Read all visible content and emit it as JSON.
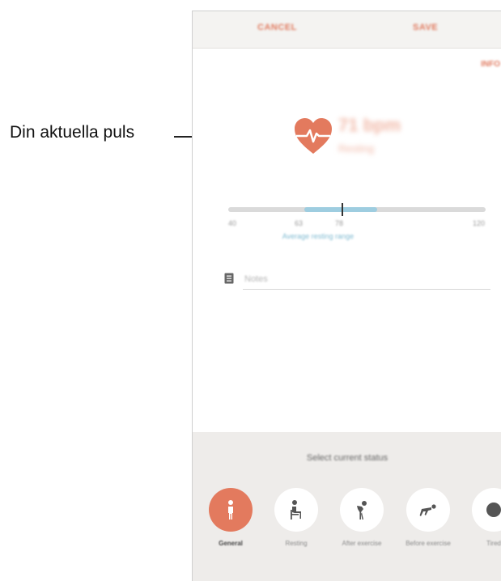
{
  "callout": {
    "label": "Din aktuella puls"
  },
  "topbar": {
    "cancel_label": "CANCEL",
    "save_label": "SAVE"
  },
  "info_link": "INFO",
  "heart_rate": {
    "value": "71 bpm",
    "sub": "Resting"
  },
  "range": {
    "ticks": [
      "40",
      "63",
      "78",
      "120"
    ],
    "label": "Average resting range",
    "fill_color": "#9ecde0",
    "marker_position_fraction": 0.31
  },
  "memo": {
    "placeholder": "Notes",
    "icon": "memo-icon"
  },
  "status": {
    "title": "Select current status",
    "items": [
      {
        "label": "General",
        "icon": "standing-person-icon",
        "active": true
      },
      {
        "label": "Resting",
        "icon": "sitting-person-icon",
        "active": false
      },
      {
        "label": "After exercise",
        "icon": "bent-over-person-icon",
        "active": false
      },
      {
        "label": "Before exercise",
        "icon": "starting-position-icon",
        "active": false
      },
      {
        "label": "Tired",
        "icon": "status-icon",
        "active": false
      }
    ]
  },
  "colors": {
    "accent": "#e37a5e",
    "panel": "#eeecea"
  }
}
